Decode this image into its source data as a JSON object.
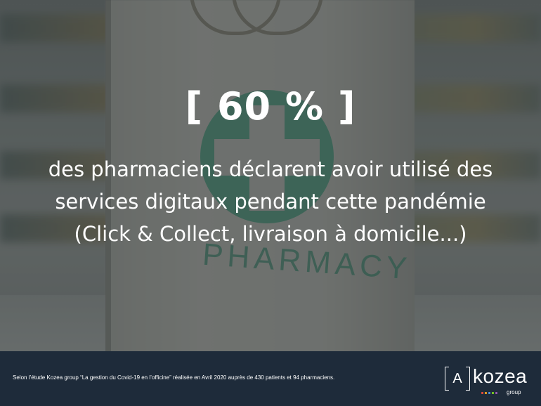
{
  "headline": "[ 60 % ]",
  "body_lines": [
    "des pharmaciens déclarent avoir utilisé des",
    "services digitaux pendant cette pandémie",
    "(Click & Collect, livraison à domicile...)"
  ],
  "background": {
    "bag_print": "PHARMACY",
    "cross_color": "#3f8b6e"
  },
  "footer": {
    "note": "Selon l’étude Kozea group “La gestion du Covid-19 en l’officine” réalisée en Avril 2020 auprès de 430 patients et 94 pharmaciens.",
    "bg_color": "#1e2b3a"
  },
  "logo": {
    "box_letter": "A",
    "word": "kozea",
    "sub": "group",
    "dot_colors": [
      "#e94b3c",
      "#f5a623",
      "#4a90e2",
      "#7ed321",
      "#9b59b6"
    ]
  }
}
